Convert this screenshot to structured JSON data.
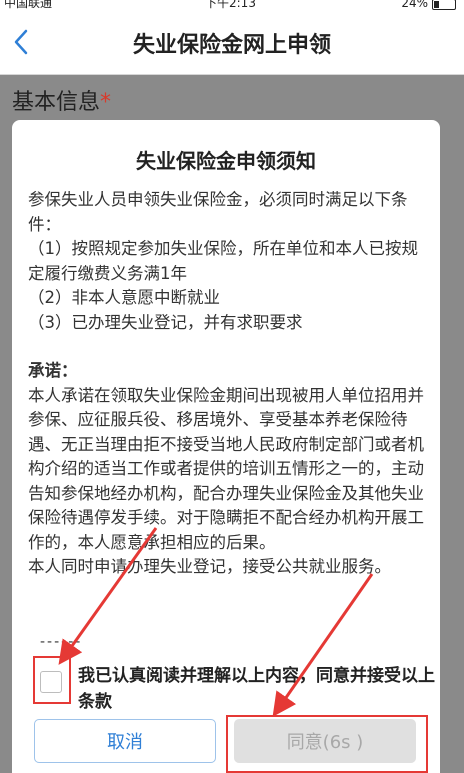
{
  "status_bar": {
    "carrier": "中国联通",
    "time": "下午2:13",
    "battery": "24%"
  },
  "nav": {
    "title": "失业保险金网上申领"
  },
  "section": {
    "heading": "基本信息",
    "required_mark": "*"
  },
  "modal": {
    "title": "失业保险金申领须知",
    "intro": "参保失业人员申领失业保险金，必须同时满足以下条件：",
    "conditions": [
      "（1）按照规定参加失业保险，所在单位和本人已按规定履行缴费义务满1年",
      "（2）非本人意愿中断就业",
      "（3）已办理失业登记，并有求职要求"
    ],
    "pledge_title": "承诺：",
    "pledge_text": "本人承诺在领取失业保险金期间出现被用人单位招用并参保、应征服兵役、移居境外、享受基本养老保险待遇、无正当理由拒不接受当地人民政府制定部门或者机构介绍的适当工作或者提供的培训五情形之一的，主动告知参保地经办机构，配合办理失业保险金及其他失业保险待遇停发手续。对于隐瞒拒不配合经办机构开展工作的，本人愿意承担相应的后果。",
    "extra_text": "本人同时申请办理失业登记，接受公共就业服务。",
    "cut_line": "------",
    "agree_text": "我已认真阅读并理解以上内容，同意并接受以上条款",
    "cancel_label": "取消",
    "agree_label": "同意(6s )"
  }
}
